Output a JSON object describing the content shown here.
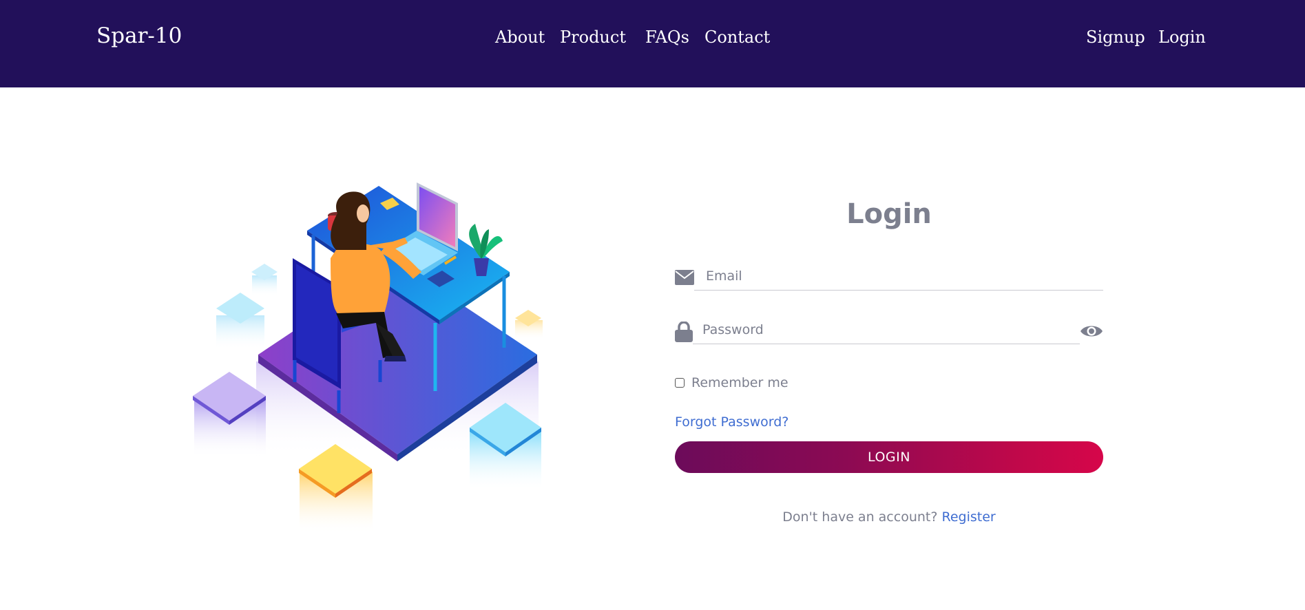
{
  "navbar": {
    "brand": "Spar-10",
    "links": [
      {
        "label": "About"
      },
      {
        "label": "Product"
      },
      {
        "label": "FAQs"
      },
      {
        "label": "Contact"
      }
    ],
    "auth": [
      {
        "label": "Signup"
      },
      {
        "label": "Login"
      }
    ]
  },
  "illustration": {
    "description_icon": "woman-at-desk-isometric-illustration"
  },
  "form": {
    "title": "Login",
    "email": {
      "placeholder": "Email",
      "value": "",
      "icon": "envelope-icon"
    },
    "password": {
      "placeholder": "Password",
      "value": "",
      "icon": "lock-icon",
      "toggle_icon": "eye-icon"
    },
    "remember_label": "Remember me",
    "remember_checked": false,
    "forgot_label": "Forgot Password?",
    "submit_label": "LOGIN",
    "register_prompt": "Don't have an account?",
    "register_link": "Register"
  },
  "colors": {
    "navbar_bg": "#22105a",
    "link_blue": "#3f6dd1",
    "button_gradient_start": "#6c0b5a",
    "button_gradient_end": "#d6064a",
    "muted_text": "#7c7f8e"
  }
}
